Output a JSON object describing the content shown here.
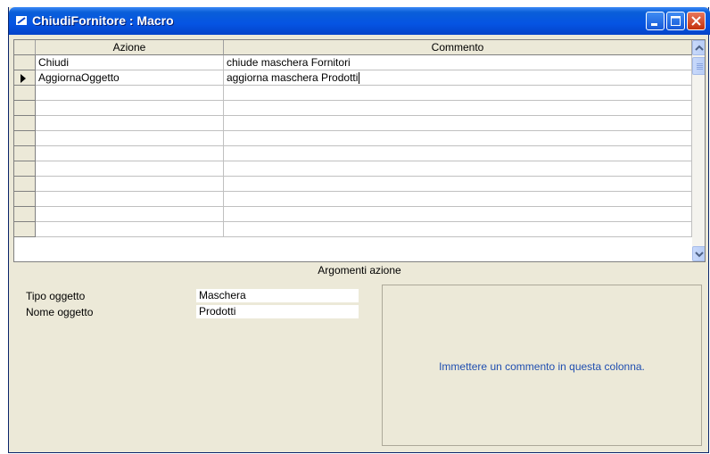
{
  "window": {
    "title": "ChiudiFornitore : Macro",
    "title_icon": "macro-icon",
    "controls": [
      "minimize-icon",
      "maximize-icon",
      "close-icon"
    ]
  },
  "grid": {
    "columns": {
      "azione": "Azione",
      "commento": "Commento"
    },
    "rows": [
      {
        "azione": "Chiudi",
        "commento": "chiude maschera Fornitori",
        "current": false
      },
      {
        "azione": "AggiornaOggetto",
        "commento": "aggiorna maschera Prodotti",
        "current": true
      }
    ],
    "empty_rows": 10
  },
  "arguments": {
    "header": "Argomenti azione",
    "fields": [
      {
        "label": "Tipo oggetto",
        "value": "Maschera"
      },
      {
        "label": "Nome oggetto",
        "value": "Prodotti"
      }
    ],
    "hint": "Immettere un commento in questa colonna."
  },
  "colors": {
    "titlebar": "#0554e3",
    "hint_text": "#1f4eb0",
    "panel_bg": "#ece9d8"
  }
}
